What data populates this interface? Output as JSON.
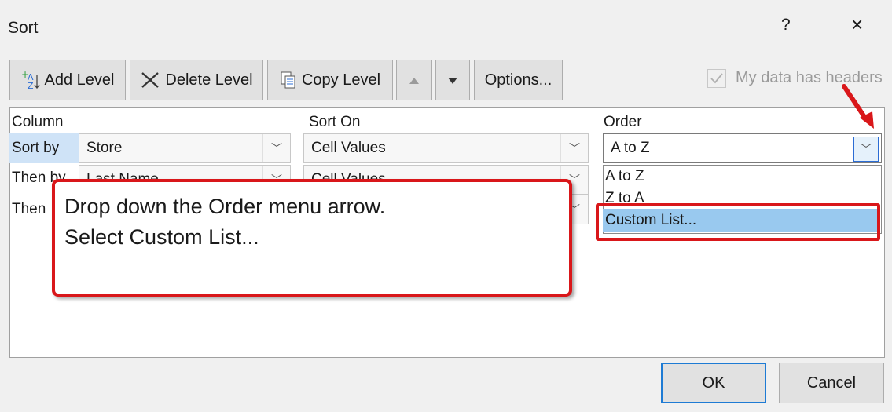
{
  "dialog": {
    "title": "Sort",
    "help": "?",
    "close": "×"
  },
  "toolbar": {
    "add_level": "Add Level",
    "delete_level": "Delete Level",
    "copy_level": "Copy Level",
    "options": "Options...",
    "headers_label": "My data has headers"
  },
  "columns": {
    "column": "Column",
    "sort_on": "Sort On",
    "order": "Order"
  },
  "rows": [
    {
      "label": "Sort by",
      "column": "Store",
      "sort_on": "Cell Values",
      "order": "A to Z"
    },
    {
      "label": "Then by",
      "column": "Last Name",
      "sort_on": "Cell Values"
    },
    {
      "label": "Then"
    }
  ],
  "order_dropdown": {
    "items": [
      "A to Z",
      "Z to A",
      "Custom List..."
    ],
    "highlighted": "Custom List..."
  },
  "callout": {
    "line1": "Drop down the Order menu arrow.",
    "line2": "Select Custom List..."
  },
  "footer": {
    "ok": "OK",
    "cancel": "Cancel"
  },
  "colors": {
    "annotation_red": "#d9171a",
    "highlight": "#99c9ef",
    "accent": "#1e7bd4"
  }
}
